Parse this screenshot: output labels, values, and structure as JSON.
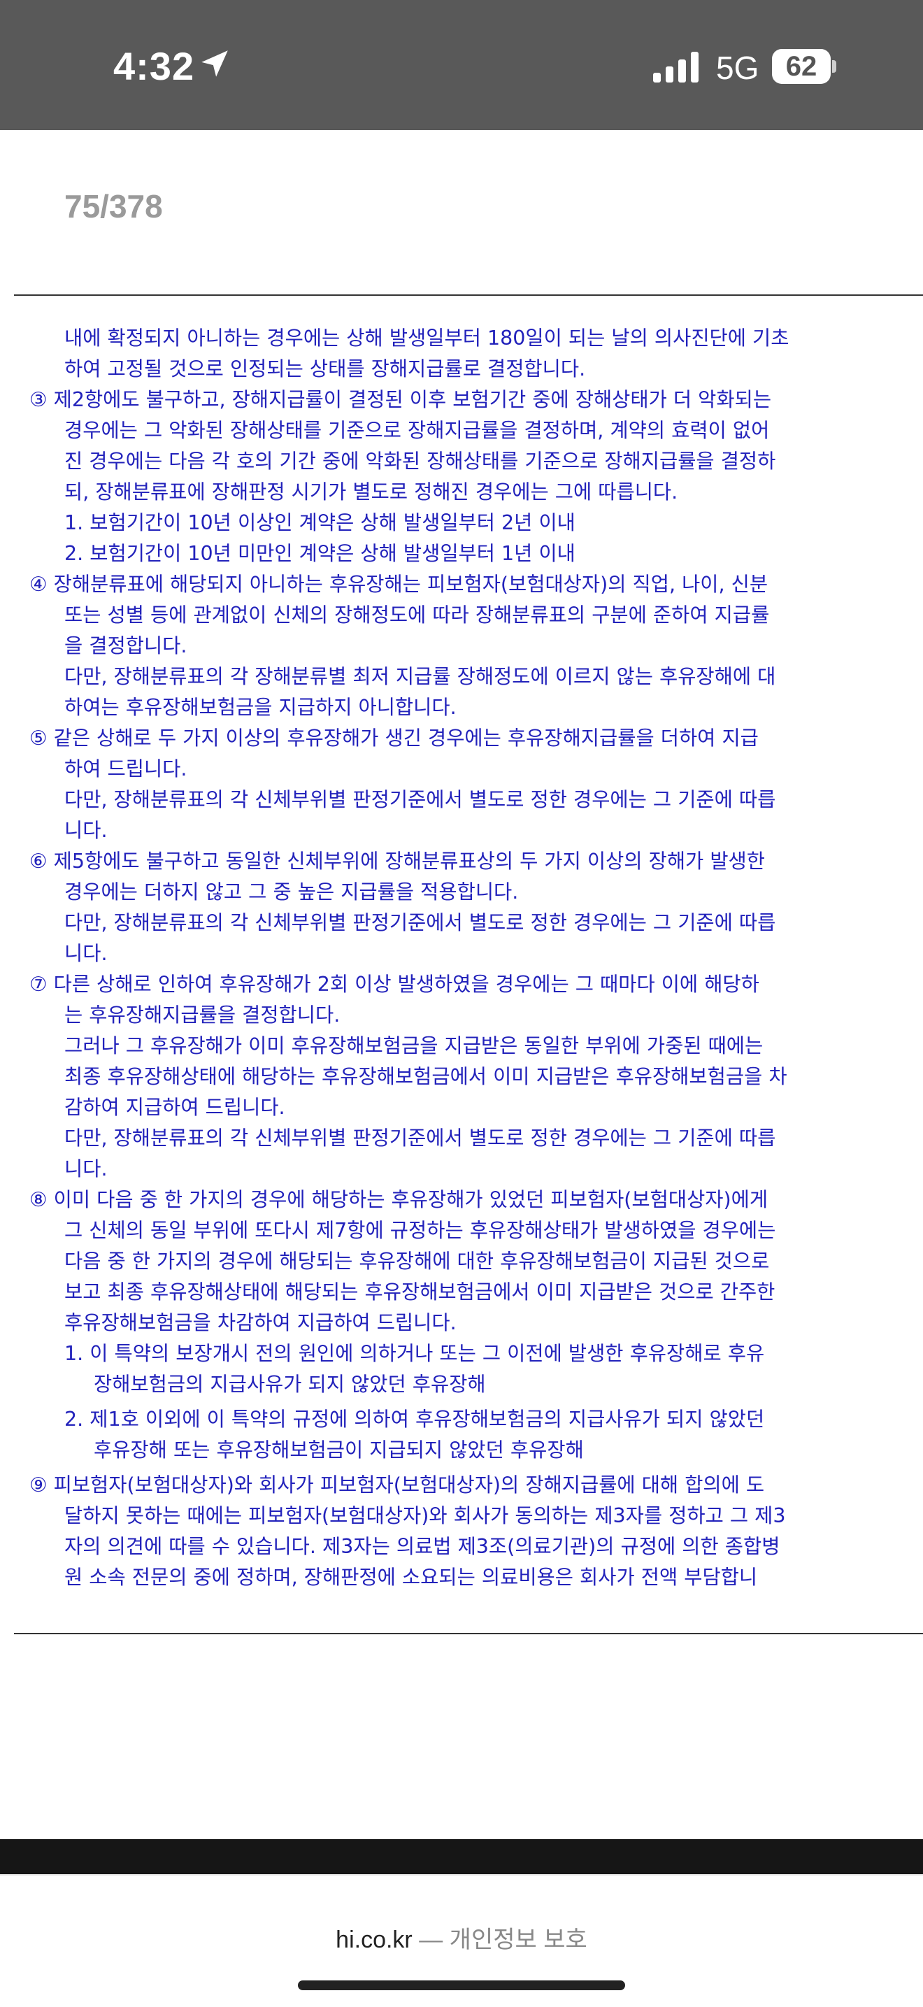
{
  "status_bar": {
    "time": "4:32",
    "network": "5G",
    "battery": "62"
  },
  "viewer": {
    "page_counter": "75/378"
  },
  "document_lines": [
    "내에 확정되지 아니하는 경우에는 상해 발생일부터 180일이 되는 날의 의사진단에 기초",
    "하여 고정될 것으로 인정되는 상태를 장해지급률로 결정합니다.",
    "③ 제2항에도 불구하고, 장해지급률이 결정된 이후 보험기간 중에 장해상태가 더 악화되는",
    "경우에는 그 악화된 장해상태를 기준으로 장해지급률을 결정하며, 계약의 효력이 없어",
    "진 경우에는 다음 각 호의 기간 중에 악화된 장해상태를 기준으로 장해지급률을 결정하",
    "되, 장해분류표에 장해판정 시기가 별도로 정해진 경우에는 그에 따릅니다.",
    "1. 보험기간이 10년 이상인 계약은 상해 발생일부터 2년 이내",
    "2. 보험기간이 10년 미만인 계약은 상해 발생일부터 1년 이내",
    "④ 장해분류표에 해당되지 아니하는 후유장해는 피보험자(보험대상자)의 직업, 나이, 신분",
    "또는 성별 등에 관계없이 신체의 장해정도에 따라 장해분류표의 구분에 준하여 지급률",
    "을 결정합니다.",
    "다만, 장해분류표의 각 장해분류별 최저 지급률 장해정도에 이르지 않는 후유장해에 대",
    "하여는 후유장해보험금을 지급하지 아니합니다.",
    "⑤ 같은 상해로 두 가지 이상의 후유장해가 생긴 경우에는 후유장해지급률을 더하여 지급",
    "하여 드립니다.",
    "다만, 장해분류표의 각 신체부위별 판정기준에서 별도로 정한 경우에는 그 기준에 따릅",
    "니다.",
    "⑥ 제5항에도 불구하고 동일한 신체부위에 장해분류표상의 두 가지 이상의 장해가 발생한",
    "경우에는 더하지 않고 그 중 높은 지급률을 적용합니다.",
    "다만, 장해분류표의 각 신체부위별 판정기준에서 별도로 정한 경우에는 그 기준에 따릅",
    "니다.",
    "⑦ 다른 상해로 인하여 후유장해가 2회 이상 발생하였을 경우에는 그 때마다 이에 해당하",
    "는 후유장해지급률을 결정합니다.",
    "그러나 그 후유장해가 이미 후유장해보험금을 지급받은 동일한 부위에 가중된 때에는",
    "최종 후유장해상태에 해당하는 후유장해보험금에서 이미 지급받은 후유장해보험금을 차",
    "감하여 지급하여 드립니다.",
    "다만, 장해분류표의 각 신체부위별 판정기준에서 별도로 정한 경우에는 그 기준에 따릅",
    "니다.",
    "⑧ 이미 다음 중 한 가지의 경우에 해당하는 후유장해가 있었던 피보험자(보험대상자)에게",
    "그 신체의 동일 부위에 또다시 제7항에 규정하는 후유장해상태가 발생하였을 경우에는",
    "다음 중 한 가지의 경우에 해당되는 후유장해에 대한 후유장해보험금이 지급된 것으로",
    "보고 최종 후유장해상태에 해당되는 후유장해보험금에서 이미 지급받은 것으로 간주한",
    "후유장해보험금을 차감하여 지급하여 드립니다.",
    "1. 이 특약의 보장개시 전의 원인에 의하거나 또는 그 이전에 발생한 후유장해로 후유",
    "장해보험금의 지급사유가 되지 않았던 후유장해",
    "2. 제1호 이외에 이 특약의 규정에 의하여 후유장해보험금의 지급사유가 되지 않았던",
    "후유장해 또는 후유장해보험금이 지급되지 않았던 후유장해",
    "⑨ 피보험자(보험대상자)와 회사가 피보험자(보험대상자)의 장해지급률에 대해 합의에 도",
    "달하지 못하는 때에는 피보험자(보험대상자)와 회사가 동의하는 제3자를 정하고 그 제3",
    "자의 의견에 따를 수 있습니다. 제3자는 의료법 제3조(의료기관)의 규정에 의한 종합병",
    "원 소속 전문의 중에 정하며, 장해판정에 소요되는 의료비용은 회사가 전액 부담합니"
  ],
  "browser": {
    "domain": "hi.co.kr",
    "separator": "—",
    "privacy_label": "개인정보 보호"
  }
}
